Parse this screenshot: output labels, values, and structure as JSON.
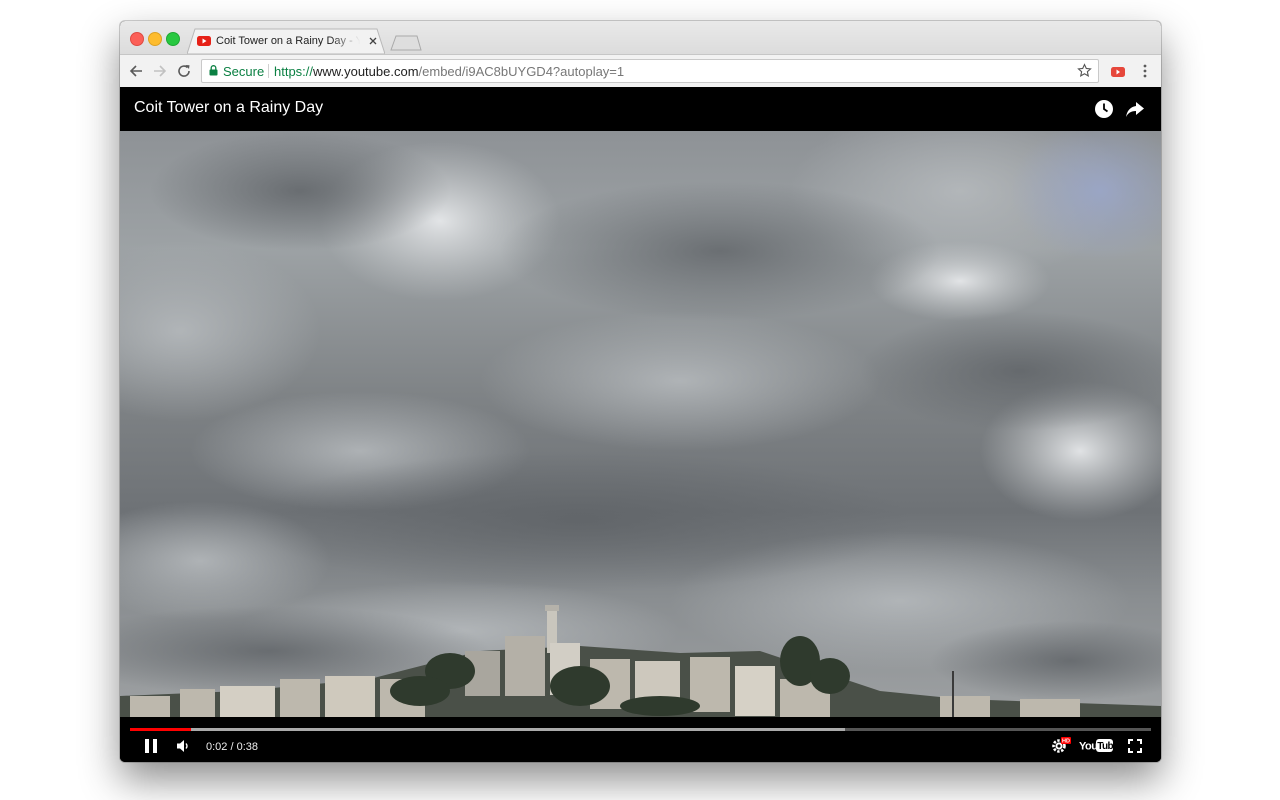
{
  "browser": {
    "tab": {
      "title": "Coit Tower on a Rainy Day - YouTube",
      "favicon": "youtube-favicon"
    },
    "toolbar": {
      "secure_label": "Secure",
      "url_scheme": "https://",
      "url_host": "www.youtube.com",
      "url_path": "/embed/i9AC8bUYGD4?autoplay=1"
    }
  },
  "player": {
    "title": "Coit Tower on a Rainy Day",
    "current_time": "0:02",
    "separator": "/",
    "duration": "0:38",
    "progress_played": 0.06,
    "progress_buffered": 0.7,
    "state": "playing",
    "hd": "HD",
    "brand_logo": "YouTube"
  },
  "colors": {
    "accent": "#ff0000",
    "secure": "#0b8043"
  }
}
